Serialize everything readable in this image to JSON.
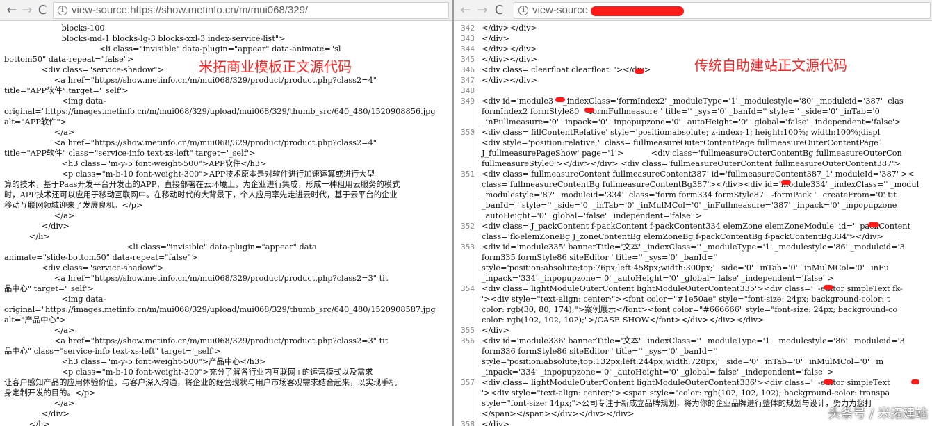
{
  "left_pane": {
    "back_label": "←",
    "forward_label": "→",
    "reload_label": "C",
    "info_label": "i",
    "url": "view-source:https://show.metinfo.cn/m/mui068/329/",
    "annotation": "米拓商业模板正文源代码",
    "lines": [
      "                       blocks-100",
      "                       blocks-md-1 blocks-lg-3 blocks-xxl-3 index-service-list\">",
      "                                      <li class=\"invisible\" data-plugin=\"appear\" data-animate=\"sl",
      "bottom50\" data-repeat=\"false\">",
      "               <div class=\"service-shadow\">",
      "                    <a href=\"https://show.metinfo.cn/m/mui068/329/product/product.php?class2=4\"",
      "title=\"APP软件\" target='_self'>",
      "                       <img data-",
      "original=\"https://images.metinfo.cn/m/mui068/329/upload/mui068/329/thumb_src/640_480/1520908856.jpg",
      "alt=\"APP软件\">",
      "                    </a>",
      "                    <a href=\"https://show.metinfo.cn/m/mui068/329/product/product.php?class2=4\"",
      "title=\"APP软件\" class=\"service-info text-xs-left\" target='_self'>",
      "                       <h3 class=\"m-y-5 font-weight-500\">APP软件</h3>",
      "                       <p class=\"m-b-10 font-weight-300\">APP技术原本是对软件进行加速运算或进行大型",
      "算的技术，基于Paas开发平台开发出的APP，直接部署在云环境上，为企业进行集成，形成一种租用云服务的模式",
      "时，APP技术还可以应用于移动互联网中。在移动时代的大背景下，个人应用率先走进云时代，基于云平台的企业",
      "移动互联网领域迎来了发展良机。</p>",
      "                    </a>",
      "               </div>",
      "          </li>",
      "                                                 <li class=\"invisible\" data-plugin=\"appear\" data",
      "animate=\"slide-bottom50\" data-repeat=\"false\">",
      "               <div class=\"service-shadow\">",
      "                    <a href=\"https://show.metinfo.cn/m/mui068/329/product/product.php?class2=3\" tit",
      "品中心\" target='_self'>",
      "                       <img data-",
      "original=\"https://images.metinfo.cn/m/mui068/329/upload/mui068/329/thumb_src/640_480/1520908587.jpg",
      "alt=\"产品中心\">",
      "                    </a>",
      "                    <a href=\"https://show.metinfo.cn/m/mui068/329/product/product.php?class2=3\" tit",
      "品中心\" class=\"service-info text-xs-left\" target='_self'>",
      "                       <h3 class=\"m-y-5 font-weight-500\">产品中心</h3>",
      "                       <p class=\"m-b-10 font-weight-300\">充分了解各行业内互联网+的运营模式以及需求",
      "让客户感知产品的应用体验价值，与客户深入沟通，将企业的经营现状与用户市场客观需求结合起来，以实现手机",
      "身定制开发的目的。</p>",
      "                    </a>",
      "               </div>",
      "          </li>"
    ]
  },
  "right_pane": {
    "back_label": "←",
    "forward_label": "→",
    "reload_label": "C",
    "info_label": "i",
    "url": "view-source",
    "annotation": "传统自助建站正文源代码",
    "lines": [
      {
        "num": "342",
        "text": "</div></div>"
      },
      {
        "num": "343",
        "text": "</div>"
      },
      {
        "num": "344",
        "text": "</div></div>"
      },
      {
        "num": "345",
        "text": "</div></div>"
      },
      {
        "num": "346",
        "text": "<div class='clearfloat clearfloat  '></div>"
      },
      {
        "num": "347",
        "text": "</div></div>"
      },
      {
        "num": "348",
        "text": ""
      },
      {
        "num": "349",
        "text": "<div id='module3  ' _indexClass='formIndex2' _moduleType='1' _modulestyle='80' _moduleid='387'  clas"
      },
      {
        "num": "",
        "text": "formIndex2 formStyle80   -formFullmeasure ' title='' _sys='0' _banId='' style='' _side='0' _inTab='0"
      },
      {
        "num": "",
        "text": "_inFullmeasure='0' _inpack='0' _inpopupzone='0' _autoHeight='0' _global='false' _independent='false'>"
      },
      {
        "num": "350",
        "text": "<div class='fillContentRelative' style='position:absolute; z-index:-1; height:100%; width:100%;displ"
      },
      {
        "num": "",
        "text": "<div style='position:relative;'  class='fullmeasureOuterContentPage fullmeasureOuterContentPage1"
      },
      {
        "num": "",
        "text": "J_fullmeasurePageShow' page='1'>           <div class='fullmeasureOuterContentBg fullmeasureOuterCon"
      },
      {
        "num": "",
        "text": "fullmeasureStyle0'></div></div> <div class='fullmeasureOuterContent fullmeasureOuterContent387'>"
      },
      {
        "num": "351",
        "text": "<div class='fullmeasureContent fullmeasureContent387' id='fullmeasureContent387_1' moduleId='387' ><"
      },
      {
        "num": "",
        "text": "class='fullmeasureContentBg fullmeasureContentBg387'></div><div id='module334' _indexClass='' _modul"
      },
      {
        "num": "",
        "text": "_modulestyle='87' _moduleid='334'  class='form form334 formStyle87   -formPack ' _createFrom='0' tit"
      },
      {
        "num": "",
        "text": "_banId='' style='' _side='0' _inTab='0' _inMulMCol='0' _inFullmeasure='387' _inpack='0' _inpopupzone"
      },
      {
        "num": "",
        "text": "_autoHeight='0' _global='false' _independent='false' >"
      },
      {
        "num": "352",
        "text": "<div class='J_packContent f-packContent f-packContent334 elemZone elemZoneModule' id='  packContent"
      },
      {
        "num": "",
        "text": "class='fk-elemZoneBg J_zoneContentBg elemZoneBg f-packContentBg f-packContentBg334'></div>"
      },
      {
        "num": "353",
        "text": "<div id='module335' bannerTitle='文本' _indexClass='' _moduleType='1' _modulestyle='86' _moduleid='3"
      },
      {
        "num": "",
        "text": "form335 formStyle86 siteEditor ' title='' _sys='0' _banId=''"
      },
      {
        "num": "",
        "text": "style='position:absolute;top:76px;left:458px;width:300px;' _side='0' _inTab='0' _inMulMCol='0' _inFu"
      },
      {
        "num": "",
        "text": "_inpack='334' _inpopupzone='0' _autoHeight='0' _global='false' _independent='false' >"
      },
      {
        "num": "354",
        "text": "<div class='lightModuleOuterContent lightModuleOuterContent335'><div class='  -editor simpleText fk-"
      },
      {
        "num": "",
        "text": "'><div style=\"text-align: center;\"><font color=\"#1e50ae\" style=\"font-size: 24px; background-color: t"
      },
      {
        "num": "",
        "text": "color: rgb(30, 80, 174);\">案例展示</font><font color=\"#666666\" style=\"font-size: 24px; background-co"
      },
      {
        "num": "",
        "text": "color: rgb(102, 102, 102);\">/CASE SHOW</font></div></div></div>"
      },
      {
        "num": "355",
        "text": "</div>"
      },
      {
        "num": "356",
        "text": "<div id='module336' bannerTitle='文本' _indexClass='' _moduleType='1' _modulestyle='86' _moduleid='3"
      },
      {
        "num": "",
        "text": "form336 formStyle86 siteEditor ' title='' _sys='0' _banId=''"
      },
      {
        "num": "",
        "text": "style='position:absolute;top:132px;left:244px;width:728px;' _side='0' _inTab='0' _inMulMCol='0' _in"
      },
      {
        "num": "",
        "text": "_inpack='334' _inpopupzone='0' _autoHeight='0' _global='false' _independent='false' >"
      },
      {
        "num": "357",
        "text": "<div class='lightModuleOuterContent lightModuleOuterContent336'><div class='  -editor simpleText  "
      },
      {
        "num": "",
        "text": "'><div style=\"text-align: center;\"><span style=\"color: rgb(102, 102, 102); background-color: transpa"
      },
      {
        "num": "",
        "text": "style=\"font-size: 14px;\">公司专注于新成立品牌规划，将为你的企业品牌进行整体的规划与设计，努力为您打"
      },
      {
        "num": "",
        "text": "</span></span></div></div></div>"
      },
      {
        "num": "358",
        "text": "</div>"
      }
    ]
  },
  "watermark": "头条号 / 米拓建站",
  "colors": {
    "annotation_red": "#ff2222",
    "redaction_red": "#ff1a1a",
    "toolbar_bg": "#f2f2f2",
    "gutter_text": "#888888"
  },
  "icons": [
    "back-arrow-icon",
    "forward-arrow-icon",
    "reload-icon",
    "info-icon"
  ]
}
